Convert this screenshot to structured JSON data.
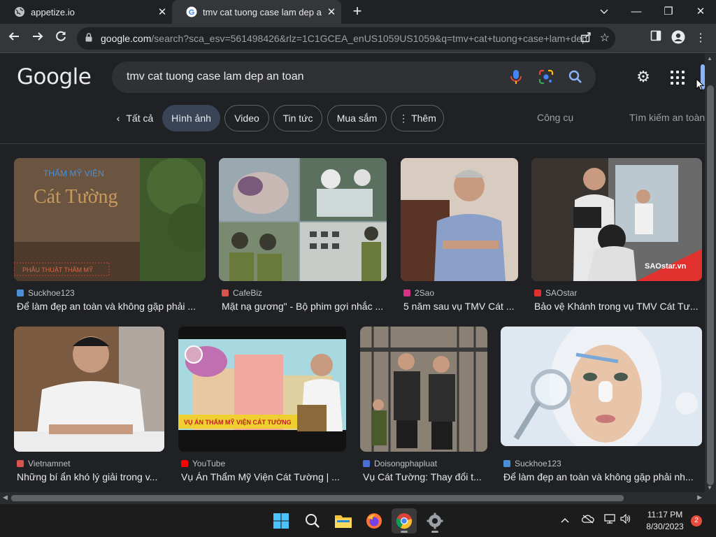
{
  "tabs": [
    {
      "title": "appetize.io",
      "active": false
    },
    {
      "title": "tmv cat tuong case lam dep an to",
      "active": true
    }
  ],
  "window": {
    "minimize": "—",
    "restore": "❐",
    "close": "✕",
    "tab_list": "⌄"
  },
  "toolbar": {
    "url_host": "google.com",
    "url_rest": "/search?sca_esv=561498426&rlz=1C1GCEA_enUS1059US1059&q=tmv+cat+tuong+case+lam+dep..."
  },
  "google": {
    "logo": "Google",
    "query": "tmv cat tuong case lam dep an toan"
  },
  "filters": {
    "all": "Tất cả",
    "images": "Hình ảnh",
    "video": "Video",
    "news": "Tin tức",
    "shopping": "Mua sắm",
    "more": "Thêm",
    "tools": "Công cụ",
    "safe_search": "Tìm kiếm an toàn"
  },
  "results": [
    {
      "source": "Suckhoe123",
      "caption": "Để làm đẹp an toàn và không gặp phải ...",
      "favicon_color": "#4a90d9",
      "scene": "building",
      "sign_top": "THẨM MỸ VIỆN",
      "sign_main": "Cát Tường",
      "sign_bottom": "PHẪU THUẬT THẨM MỸ"
    },
    {
      "source": "CafeBiz",
      "caption": "Mặt nạ gương\" - Bộ phim gợi nhắc ...",
      "favicon_color": "#d9534f",
      "scene": "collage"
    },
    {
      "source": "2Sao",
      "caption": "5 năm sau vụ TMV Cát ...",
      "favicon_color": "#d63384",
      "scene": "portrait"
    },
    {
      "source": "SAOstar",
      "caption": "Bảo vệ Khánh trong vụ TMV Cát Tư...",
      "favicon_color": "#e0312f",
      "scene": "barber",
      "watermark": "SAOstar.vn"
    },
    {
      "source": "Vietnamnet",
      "caption": "Những bí ẩn khó lý giải trong v...",
      "favicon_color": "#d9534f",
      "scene": "man"
    },
    {
      "source": "YouTube",
      "caption": "Vụ Án Thẩm Mỹ Viện Cát Tường | ...",
      "favicon_color": "#ff0000",
      "scene": "cartoon",
      "banner": "VỤ ÁN THẨM MỸ VIỆN CÁT TƯỜNG"
    },
    {
      "source": "Doisongphapluat",
      "caption": "Vụ Cát Tường: Thay đổi t...",
      "favicon_color": "#4a6fd9",
      "scene": "court"
    },
    {
      "source": "Suckhoe123",
      "caption": "Để làm đẹp an toàn và không gặp phải nh...",
      "favicon_color": "#4a90d9",
      "scene": "face"
    }
  ],
  "taskbar": {
    "time": "11:17 PM",
    "date": "8/30/2023",
    "notifications": "2"
  }
}
